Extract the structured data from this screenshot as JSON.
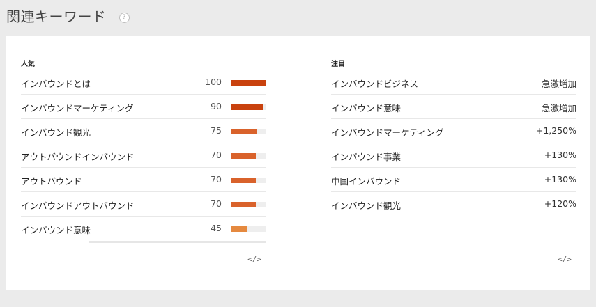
{
  "header": {
    "title": "関連キーワード",
    "help_glyph": "?"
  },
  "popular": {
    "heading": "人気",
    "rows": [
      {
        "keyword": "インバウンドとは",
        "value": "100",
        "level": 100,
        "color": "#c9420e"
      },
      {
        "keyword": "インバウンドマーケティング",
        "value": "90",
        "level": 90,
        "color": "#c9420e"
      },
      {
        "keyword": "インバウンド観光",
        "value": "75",
        "level": 75,
        "color": "#d9622b"
      },
      {
        "keyword": "アウトバウンドインバウンド",
        "value": "70",
        "level": 70,
        "color": "#d9622b"
      },
      {
        "keyword": "アウトバウンド",
        "value": "70",
        "level": 70,
        "color": "#d9622b"
      },
      {
        "keyword": "インバウンドアウトバウンド",
        "value": "70",
        "level": 70,
        "color": "#d9622b"
      },
      {
        "keyword": "インバウンド意味",
        "value": "45",
        "level": 45,
        "color": "#e5893f"
      }
    ],
    "embed_icon": "</>"
  },
  "rising": {
    "heading": "注目",
    "rows": [
      {
        "keyword": "インバウンドビジネス",
        "change": "急激増加"
      },
      {
        "keyword": "インバウンド意味",
        "change": "急激増加"
      },
      {
        "keyword": "インバウンドマーケティング",
        "change": "+1,250%"
      },
      {
        "keyword": "インバウンド事業",
        "change": "+130%"
      },
      {
        "keyword": "中国インバウンド",
        "change": "+130%"
      },
      {
        "keyword": "インバウンド観光",
        "change": "+120%"
      }
    ],
    "embed_icon": "</>"
  }
}
